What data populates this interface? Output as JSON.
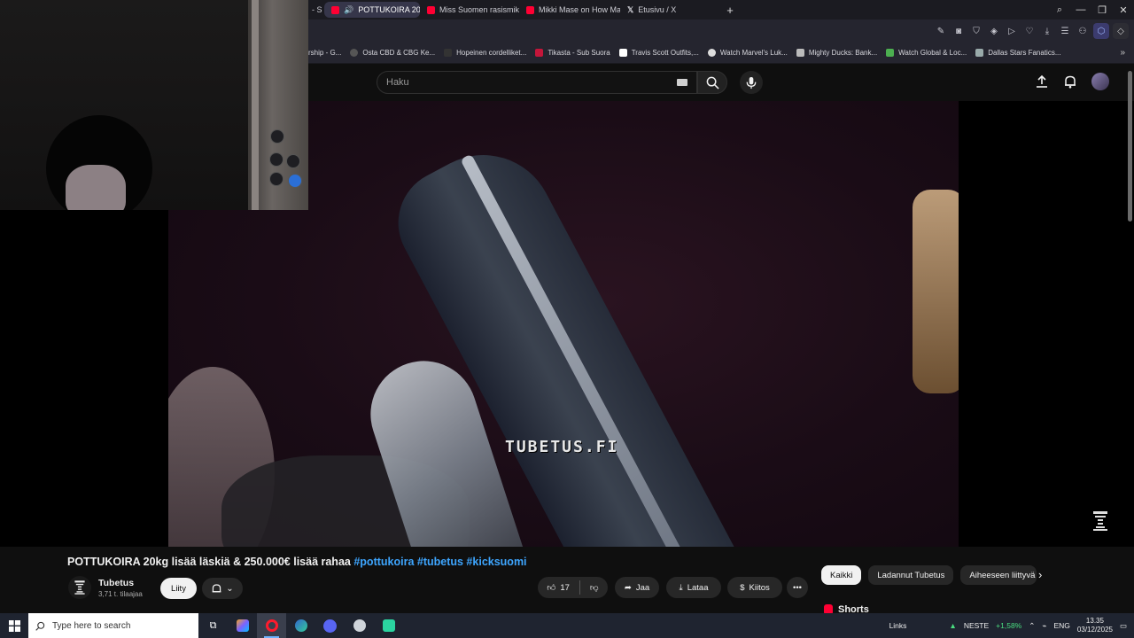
{
  "browser": {
    "tabs": [
      {
        "label": "- S",
        "color": "#888888"
      },
      {
        "label": "POTTUKOIRA 20kg lisä",
        "color": "#ff0033",
        "active": true
      },
      {
        "label": "Miss Suomen rasismikohu",
        "color": "#ff0033"
      },
      {
        "label": "Mikki Mase on How Mafi",
        "color": "#ff0033"
      },
      {
        "label": "Etusivu / X",
        "color": "#ffffff"
      }
    ],
    "new_tab": "+",
    "bookmarks": [
      {
        "label": "rship - G..."
      },
      {
        "label": "Osta CBD & CBG Ke..."
      },
      {
        "label": "Hopeinen cordelliket..."
      },
      {
        "label": "Tikasta - Sub Suora"
      },
      {
        "label": "Travis Scott Outfits,..."
      },
      {
        "label": "Watch Marvel's Luk..."
      },
      {
        "label": "Mighty Ducks: Bank..."
      },
      {
        "label": "Watch Global & Loc..."
      },
      {
        "label": "Dallas Stars Fanatics..."
      }
    ]
  },
  "youtube": {
    "search_placeholder": "Haku",
    "video": {
      "watermark": "TUBETUS.FI",
      "title": "POTTUKOIRA 20kg lisää läskiä & 250.000€ lisää rahaa",
      "hashtags": "#pottukoira #tubetus #kicksuomi"
    },
    "channel": {
      "name": "Tubetus",
      "subscribers": "3,71 t. tilaajaa",
      "join_label": "Liity"
    },
    "actions": {
      "likes": "17",
      "share": "Jaa",
      "download": "Lataa",
      "thanks": "Kiitos"
    },
    "chips": [
      "Kaikki",
      "Ladannut Tubetus",
      "Aiheeseen liittyvä"
    ],
    "shorts_label": "Shorts"
  },
  "taskbar": {
    "search_placeholder": "Type here to search",
    "links_label": "Links",
    "stock_name": "NESTE",
    "stock_change": "+1,58%",
    "language": "ENG",
    "time": "13.35",
    "date": "03/12/2025"
  }
}
